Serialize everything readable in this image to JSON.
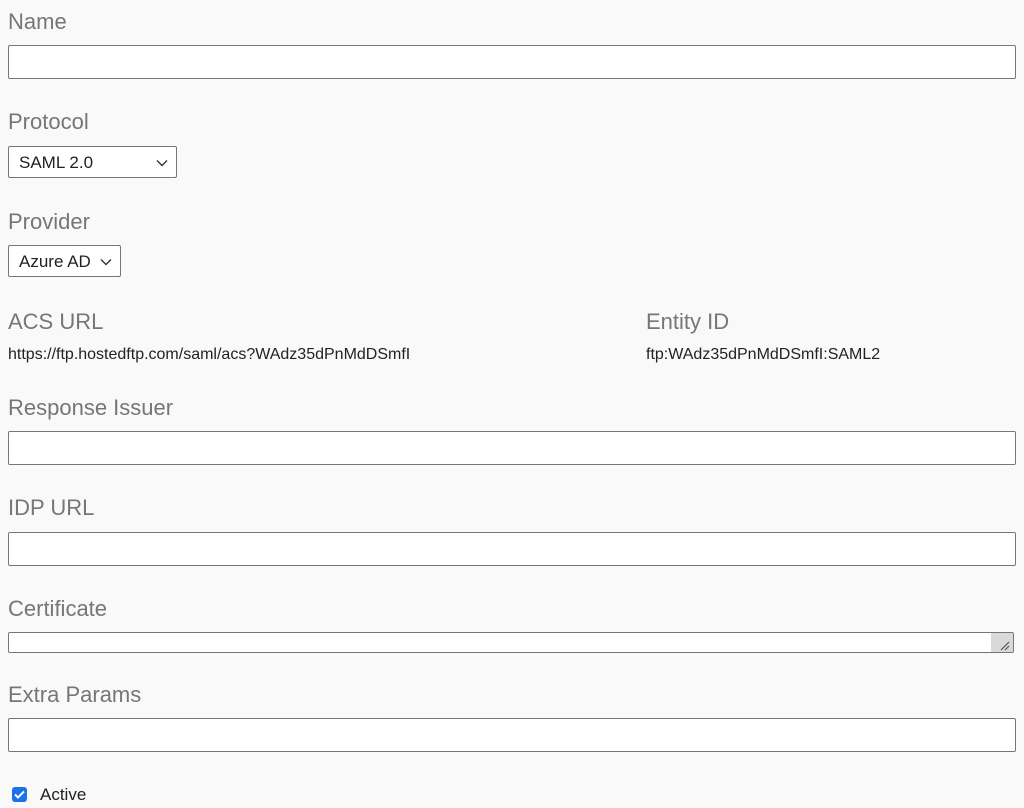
{
  "form": {
    "name": {
      "label": "Name",
      "value": ""
    },
    "protocol": {
      "label": "Protocol",
      "selected": "SAML 2.0"
    },
    "provider": {
      "label": "Provider",
      "selected": "Azure AD"
    },
    "acs_url": {
      "label": "ACS URL",
      "value": "https://ftp.hostedftp.com/saml/acs?WAdz35dPnMdDSmfI"
    },
    "entity_id": {
      "label": "Entity ID",
      "value": "ftp:WAdz35dPnMdDSmfI:SAML2"
    },
    "response_issuer": {
      "label": "Response Issuer",
      "value": ""
    },
    "idp_url": {
      "label": "IDP URL",
      "value": ""
    },
    "certificate": {
      "label": "Certificate",
      "value": ""
    },
    "extra_params": {
      "label": "Extra Params",
      "value": ""
    },
    "active": {
      "label": "Active",
      "checked": true
    }
  },
  "colors": {
    "label": "#767676",
    "border": "#767676",
    "accent": "#1a73e8",
    "background": "#f9f9f9"
  },
  "icons": {
    "dropdown": "chevron-down-icon",
    "resize": "resize-grip-icon",
    "check": "checkmark-icon"
  }
}
